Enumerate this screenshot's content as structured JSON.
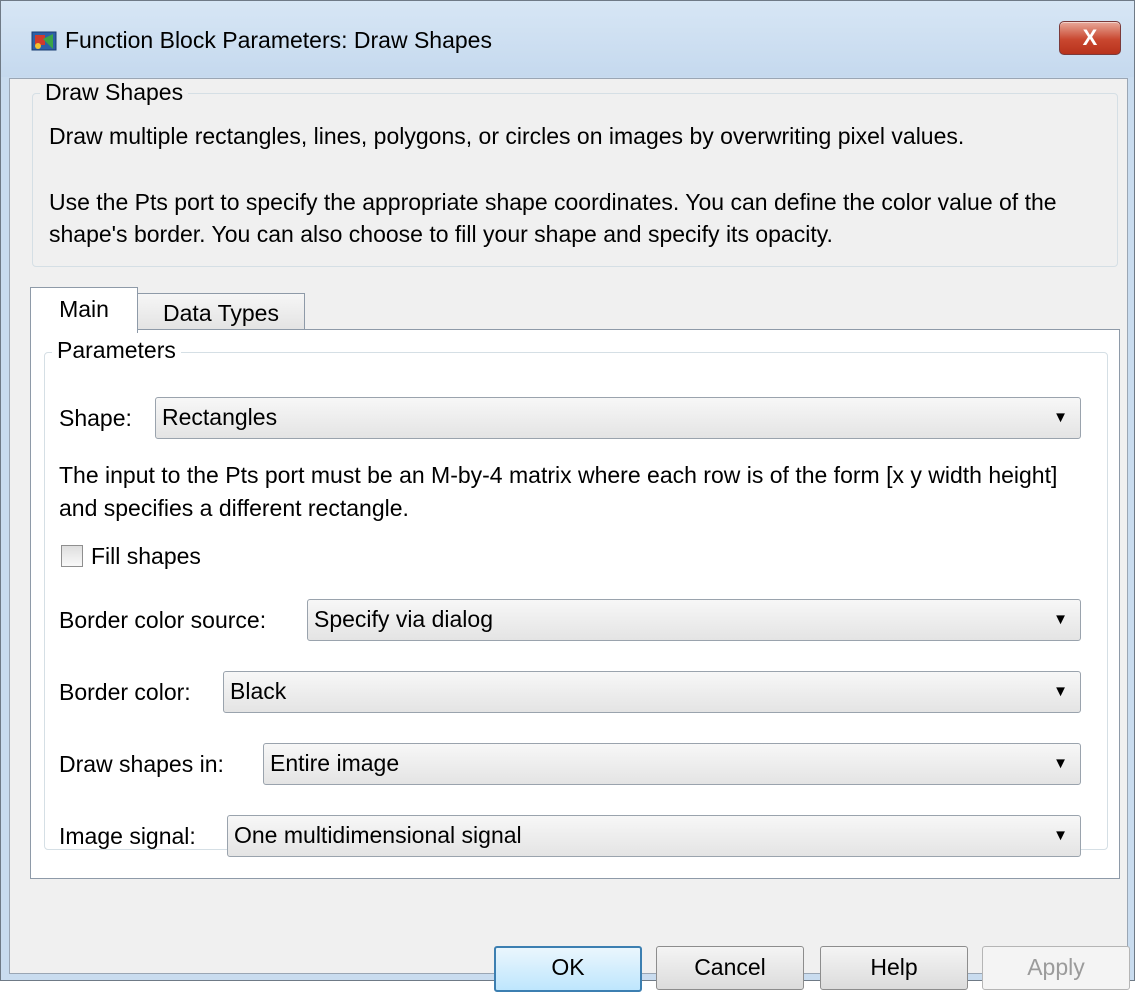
{
  "window": {
    "title": "Function Block Parameters: Draw Shapes",
    "close_label": "X"
  },
  "description": {
    "group_title": "Draw Shapes",
    "line1": "Draw multiple rectangles, lines, polygons, or circles on images by overwriting pixel values.",
    "line2": "Use the Pts port to specify the appropriate shape coordinates. You can define the color value of the shape's border. You can also choose to fill your shape and specify its opacity."
  },
  "tabs": [
    {
      "label": "Main",
      "active": true
    },
    {
      "label": "Data Types",
      "active": false
    }
  ],
  "parameters": {
    "group_title": "Parameters",
    "shape": {
      "label": "Shape:",
      "value": "Rectangles"
    },
    "info": "The input to the Pts port must be an M-by-4 matrix where each row is of the form [x y width height] and specifies a different rectangle.",
    "fill_shapes": {
      "label": "Fill shapes",
      "checked": false
    },
    "border_color_source": {
      "label": "Border color source:",
      "value": "Specify via dialog"
    },
    "border_color": {
      "label": "Border color:",
      "value": "Black"
    },
    "draw_shapes_in": {
      "label": "Draw shapes in:",
      "value": "Entire image"
    },
    "image_signal": {
      "label": "Image signal:",
      "value": "One multidimensional signal"
    }
  },
  "buttons": {
    "ok": "OK",
    "cancel": "Cancel",
    "help": "Help",
    "apply": "Apply"
  },
  "icons": {
    "app": "simulink-block-icon",
    "dropdown": "chevron-down-icon"
  },
  "colors": {
    "titlebar": "#c9dcef",
    "close_button": "#c9472f",
    "default_button_border": "#3c7fb1"
  }
}
